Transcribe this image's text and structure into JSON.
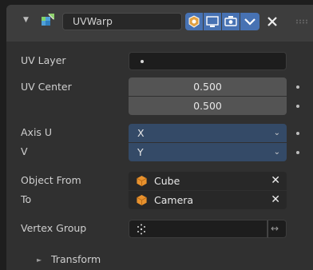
{
  "modifier": {
    "name": "UVWarp",
    "icons": {
      "collapse": "triangle-down-icon",
      "type": "uvwarp-modifier-icon",
      "edit_mode": "edit-mode-icon",
      "realtime": "realtime-display-icon",
      "render": "render-camera-icon",
      "menu": "chevron-down-icon",
      "remove": "close-icon",
      "drag": "drag-handle-icon"
    }
  },
  "fields": {
    "uv_layer": {
      "label": "UV Layer",
      "value": ""
    },
    "uv_center": {
      "label": "UV Center",
      "values": [
        "0.500",
        "0.500"
      ]
    },
    "axis_u": {
      "label": "Axis U",
      "value": "X"
    },
    "axis_v": {
      "label": "V",
      "value": "Y"
    },
    "object_from": {
      "label": "Object From",
      "value": "Cube"
    },
    "object_to": {
      "label": "To",
      "value": "Camera"
    },
    "vertex_group": {
      "label": "Vertex Group",
      "value": ""
    }
  },
  "subpanel": {
    "label": "Transform"
  },
  "colors": {
    "accent_blue": "#344a67",
    "object_orange": "#e8922e",
    "panel": "#303030"
  }
}
